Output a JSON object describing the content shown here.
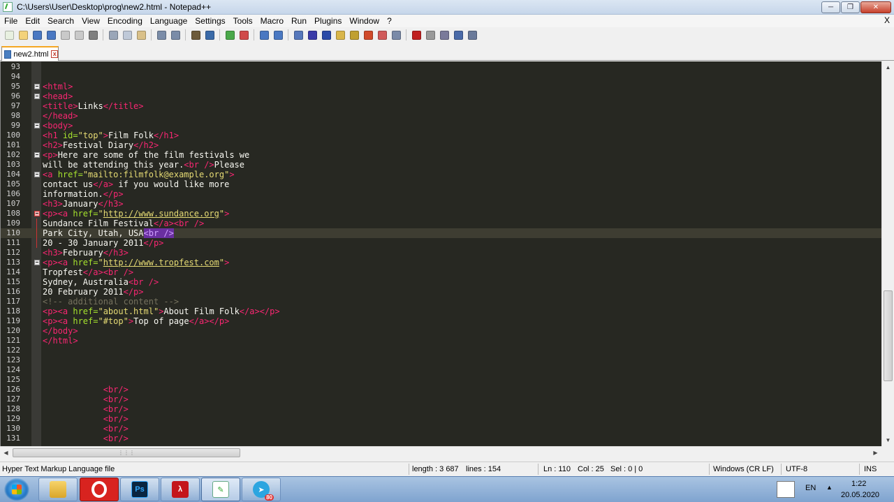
{
  "window": {
    "title": "C:\\Users\\User\\Desktop\\prog\\new2.html - Notepad++"
  },
  "menu": [
    "File",
    "Edit",
    "Search",
    "View",
    "Encoding",
    "Language",
    "Settings",
    "Tools",
    "Macro",
    "Run",
    "Plugins",
    "Window",
    "?"
  ],
  "menu_close": "X",
  "toolbar_icons": [
    "new-file-icon",
    "open-file-icon",
    "save-icon",
    "save-all-icon",
    "close-icon",
    "close-all-icon",
    "print-icon",
    "|",
    "cut-icon",
    "copy-icon",
    "paste-icon",
    "|",
    "undo-icon",
    "redo-icon",
    "|",
    "find-icon",
    "replace-icon",
    "|",
    "zoom-in-icon",
    "zoom-out-icon",
    "|",
    "sync-vertical-icon",
    "sync-horizontal-icon",
    "|",
    "word-wrap-icon",
    "show-all-chars-icon",
    "indent-guide-icon",
    "user-language-icon",
    "doc-map-icon",
    "function-list-icon",
    "folder-workspace-icon",
    "monitoring-icon",
    "|",
    "record-macro-icon",
    "stop-macro-icon",
    "play-macro-icon",
    "run-macro-multiple-icon",
    "save-macro-icon"
  ],
  "tab": {
    "label": "new2.html",
    "close": "x"
  },
  "editor": {
    "current_line": 110,
    "lines": [
      {
        "n": "93",
        "html": ""
      },
      {
        "n": "94",
        "html": ""
      },
      {
        "n": "95",
        "fold": "box",
        "html": "<span class='tag'>&lt;html&gt;</span>"
      },
      {
        "n": "96",
        "fold": "box",
        "html": "<span class='tag'>&lt;head&gt;</span>"
      },
      {
        "n": "97",
        "html": "<span class='tag'>&lt;title&gt;</span>Links<span class='tag'>&lt;/title&gt;</span>"
      },
      {
        "n": "98",
        "html": "<span class='tag'>&lt;/head&gt;</span>"
      },
      {
        "n": "99",
        "fold": "box",
        "html": "<span class='tag'>&lt;body&gt;</span>"
      },
      {
        "n": "100",
        "html": "<span class='tag'>&lt;h1 </span><span class='attr'>id=</span><span class='str'>\"top\"</span><span class='tag'>&gt;</span>Film Folk<span class='tag'>&lt;/h1&gt;</span>"
      },
      {
        "n": "101",
        "html": "<span class='tag'>&lt;h2&gt;</span>Festival Diary<span class='tag'>&lt;/h2&gt;</span>"
      },
      {
        "n": "102",
        "fold": "box",
        "html": "<span class='tag'>&lt;p&gt;</span>Here are some of the film festivals we"
      },
      {
        "n": "103",
        "html": "will be attending this year.<span class='tag'>&lt;br /&gt;</span>Please"
      },
      {
        "n": "104",
        "fold": "box",
        "html": "<span class='tag'>&lt;a </span><span class='attr'>href=</span><span class='str'>\"mailto:filmfolk@example.org\"</span><span class='tag'>&gt;</span>"
      },
      {
        "n": "105",
        "html": "contact us<span class='tag'>&lt;/a&gt;</span> if you would like more"
      },
      {
        "n": "106",
        "html": "information.<span class='tag'>&lt;/p&gt;</span>"
      },
      {
        "n": "107",
        "html": "<span class='tag'>&lt;h3&gt;</span>January<span class='tag'>&lt;/h3&gt;</span>"
      },
      {
        "n": "108",
        "fold": "red",
        "html": "<span class='tag'>&lt;p&gt;&lt;a </span><span class='attr'>href=</span><span class='str'>\"</span><span class='url'>http://www.sundance.org</span><span class='str'>\"</span><span class='tag'>&gt;</span>"
      },
      {
        "n": "109",
        "fold": "redline",
        "html": "Sundance Film Festival<span class='tag'>&lt;/a&gt;&lt;br /&gt;</span>"
      },
      {
        "n": "110",
        "fold": "redline",
        "html": "Park City, Utah, USA<span class='sel'>&lt;br /&gt;</span>"
      },
      {
        "n": "111",
        "fold": "redline",
        "html": "20 - 30 January 2011<span class='tag'>&lt;/p&gt;</span>"
      },
      {
        "n": "112",
        "html": "<span class='tag'>&lt;h3&gt;</span>February<span class='tag'>&lt;/h3&gt;</span>"
      },
      {
        "n": "113",
        "fold": "box",
        "html": "<span class='tag'>&lt;p&gt;&lt;a </span><span class='attr'>href=</span><span class='str'>\"</span><span class='url'>http://www.tropfest.com</span><span class='str'>\"</span><span class='tag'>&gt;</span>"
      },
      {
        "n": "114",
        "html": "Tropfest<span class='tag'>&lt;/a&gt;&lt;br /&gt;</span>"
      },
      {
        "n": "115",
        "html": "Sydney, Australia<span class='tag'>&lt;br /&gt;</span>"
      },
      {
        "n": "116",
        "html": "20 February 2011<span class='tag'>&lt;/p&gt;</span>"
      },
      {
        "n": "117",
        "html": "<span class='cmt'>&lt;!-- additional content --&gt;</span>"
      },
      {
        "n": "118",
        "html": "<span class='tag'>&lt;p&gt;&lt;a </span><span class='attr'>href=</span><span class='str'>\"about.html\"</span><span class='tag'>&gt;</span>About Film Folk<span class='tag'>&lt;/a&gt;&lt;/p&gt;</span>"
      },
      {
        "n": "119",
        "html": "<span class='tag'>&lt;p&gt;&lt;a </span><span class='attr'>href=</span><span class='str'>\"#top\"</span><span class='tag'>&gt;</span>Top of page<span class='tag'>&lt;/a&gt;&lt;/p&gt;</span>"
      },
      {
        "n": "120",
        "html": "<span class='tag'>&lt;/body&gt;</span>"
      },
      {
        "n": "121",
        "html": "<span class='tag'>&lt;/html&gt;</span>"
      },
      {
        "n": "122",
        "html": ""
      },
      {
        "n": "123",
        "html": ""
      },
      {
        "n": "124",
        "html": ""
      },
      {
        "n": "125",
        "html": ""
      },
      {
        "n": "126",
        "html": "            <span class='tag'>&lt;br/&gt;</span>"
      },
      {
        "n": "127",
        "html": "            <span class='tag'>&lt;br/&gt;</span>"
      },
      {
        "n": "128",
        "html": "            <span class='tag'>&lt;br/&gt;</span>"
      },
      {
        "n": "129",
        "html": "            <span class='tag'>&lt;br/&gt;</span>"
      },
      {
        "n": "130",
        "html": "            <span class='tag'>&lt;br/&gt;</span>"
      },
      {
        "n": "131",
        "html": "            <span class='tag'>&lt;br/&gt;</span>"
      }
    ]
  },
  "status": {
    "file_type": "Hyper Text Markup Language file",
    "length": "length : 3 687",
    "lines": "lines : 154",
    "ln": "Ln : 110",
    "col": "Col : 25",
    "sel": "Sel : 0 | 0",
    "eol": "Windows (CR LF)",
    "encoding": "UTF-8",
    "mode": "INS"
  },
  "taskbar": {
    "ps_label": "Ps",
    "telegram_badge": "80",
    "language": "EN",
    "time": "1:22",
    "date": "20.05.2020"
  },
  "colors": {
    "editor_bg": "#272822",
    "tag": "#f92672",
    "attr": "#a6e22e",
    "string": "#e6db74",
    "comment": "#75715e",
    "selection": "#6a2fa0"
  }
}
